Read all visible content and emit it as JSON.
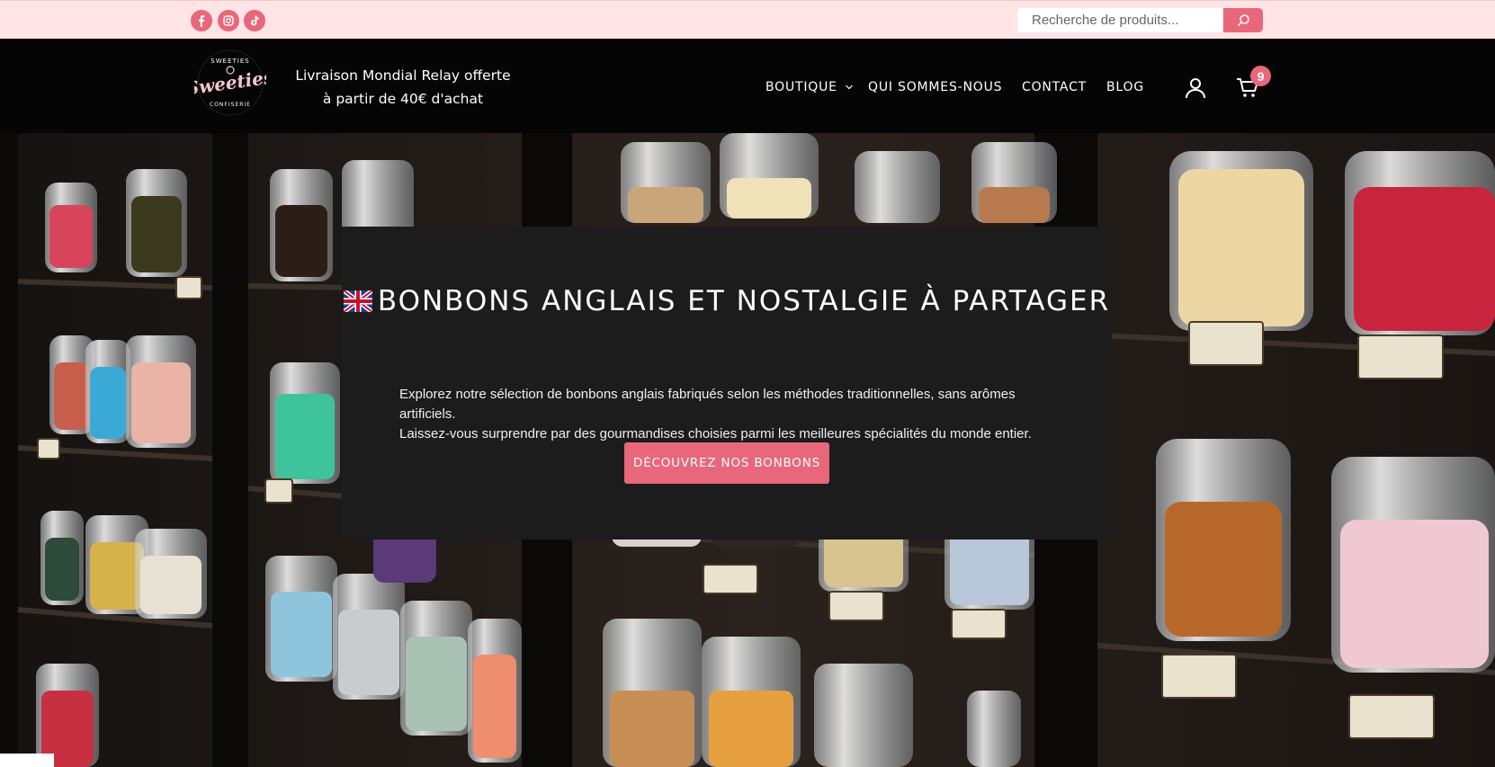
{
  "topbar": {
    "social": [
      {
        "name": "facebook-icon"
      },
      {
        "name": "instagram-icon"
      },
      {
        "name": "tiktok-icon"
      }
    ],
    "search": {
      "placeholder": "Recherche de produits..."
    }
  },
  "header": {
    "logo": {
      "top_text": "SWEETIES",
      "main_text": "Sweeties",
      "bottom_text": "CONFISERIE"
    },
    "promo_line1": "Livraison Mondial Relay offerte",
    "promo_line2": "à partir de 40€ d'achat",
    "nav": {
      "boutique": "BOUTIQUE",
      "qui": "QUI SOMMES-NOUS",
      "contact": "CONTACT",
      "blog": "BLOG"
    },
    "cart_count": "9"
  },
  "hero": {
    "title": "BONBONS ANGLAIS ET NOSTALGIE À PARTAGER",
    "desc_line1": "Explorez notre sélection de bonbons anglais fabriqués selon les méthodes traditionnelles, sans arômes artificiels.",
    "desc_line2": "Laissez-vous surprendre par des gourmandises choisies parmi les meilleures spécialités du monde entier.",
    "cta": "DÉCOUVREZ NOS BONBONS"
  },
  "colors": {
    "accent": "#e8677a",
    "topbar_bg": "#ffe4e6",
    "header_bg": "#050505",
    "overlay_bg": "#1c1c1c"
  }
}
